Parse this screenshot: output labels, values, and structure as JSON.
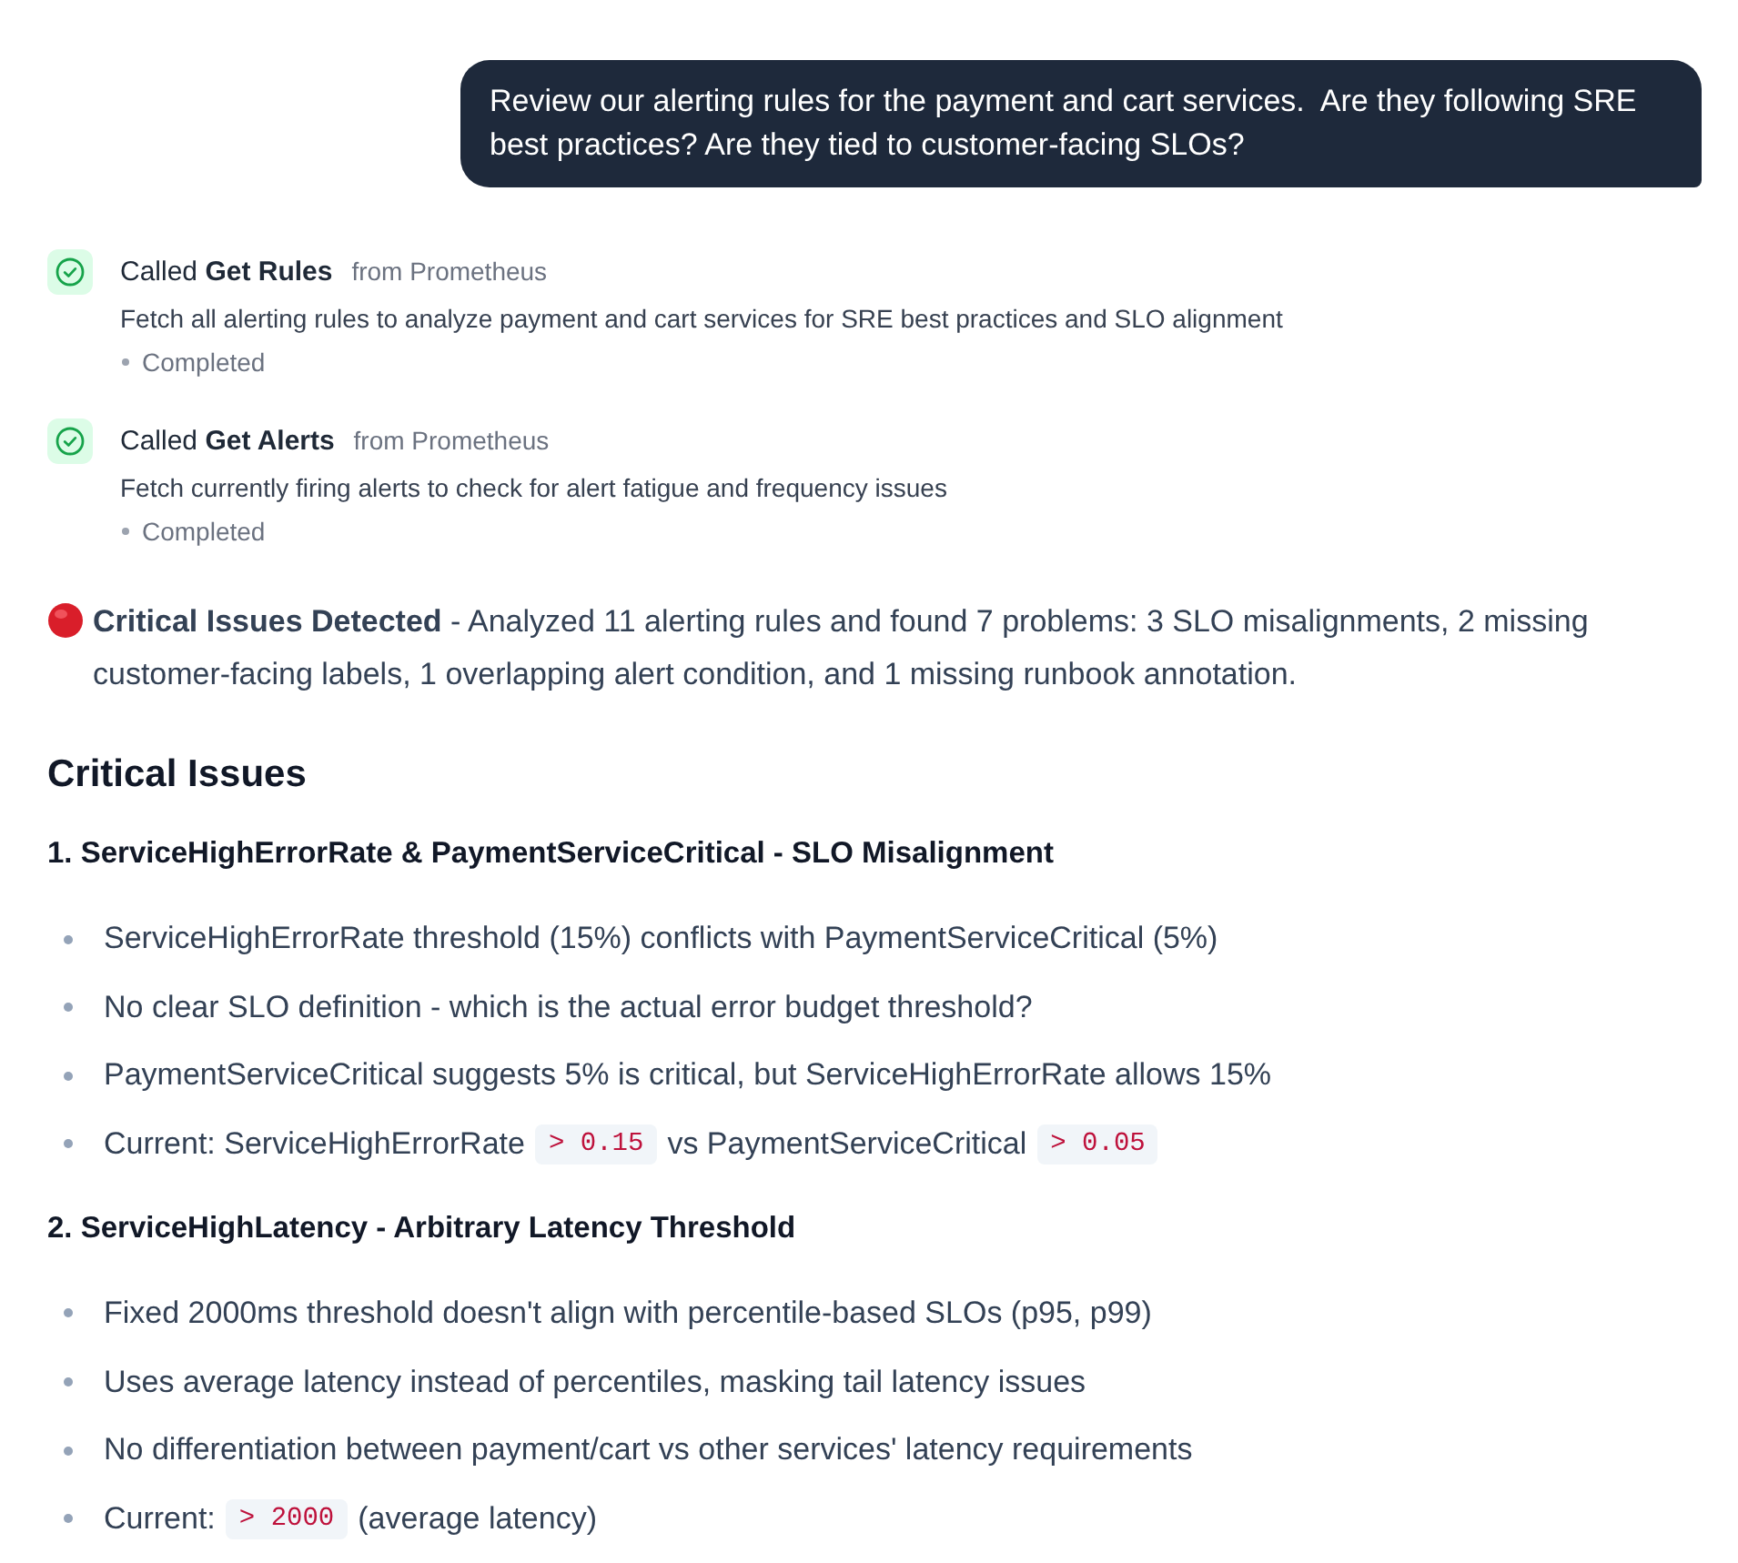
{
  "user_message": {
    "text": "Review our alerting rules for the payment and cart services.  Are they following SRE best practices? Are they tied to customer-facing SLOs?"
  },
  "tool_calls": [
    {
      "title": "Called **Get Rules**",
      "source": "from Prometheus",
      "description": "Fetch all alerting rules to analyze payment and cart services for SRE best practices and SLO alignment",
      "status": "Completed"
    },
    {
      "title": "Called **Get Alerts**",
      "source": "from Prometheus",
      "description": "Fetch currently firing alerts to check for alert fatigue and frequency issues",
      "status": "Completed"
    }
  ],
  "summary": {
    "text": "**Critical Issues Detected** - Analyzed 11 alerting rules and found 7 problems: 3 SLO misalignments, 2 missing customer-facing labels, 1 overlapping alert condition, and 1 missing runbook annotation."
  },
  "section": {
    "heading": "Critical Issues",
    "issues": [
      {
        "title": "1. ServiceHighErrorRate & PaymentServiceCritical - SLO Misalignment",
        "bullets": [
          [
            {
              "kind": "text",
              "text": "ServiceHighErrorRate threshold (15%) conflicts with PaymentServiceCritical (5%)"
            }
          ],
          [
            {
              "kind": "text",
              "text": "No clear SLO definition - which is the actual error budget threshold?"
            }
          ],
          [
            {
              "kind": "text",
              "text": "PaymentServiceCritical suggests 5% is critical, but ServiceHighErrorRate allows 15%"
            }
          ],
          [
            {
              "kind": "text",
              "text": "Current: ServiceHighErrorRate"
            },
            {
              "kind": "code",
              "text": "> 0.15"
            },
            {
              "kind": "text",
              "text": "vs PaymentServiceCritical"
            },
            {
              "kind": "code",
              "text": "> 0.05"
            }
          ]
        ]
      },
      {
        "title": "2. ServiceHighLatency - Arbitrary Latency Threshold",
        "bullets": [
          [
            {
              "kind": "text",
              "text": "Fixed 2000ms threshold doesn't align with percentile-based SLOs (p95, p99)"
            }
          ],
          [
            {
              "kind": "text",
              "text": "Uses average latency instead of percentiles, masking tail latency issues"
            }
          ],
          [
            {
              "kind": "text",
              "text": "No differentiation between payment/cart vs other services' latency requirements"
            }
          ],
          [
            {
              "kind": "text",
              "text": "Current:"
            },
            {
              "kind": "code",
              "text": "> 2000"
            },
            {
              "kind": "text",
              "text": "(average latency)"
            }
          ]
        ]
      }
    ]
  }
}
